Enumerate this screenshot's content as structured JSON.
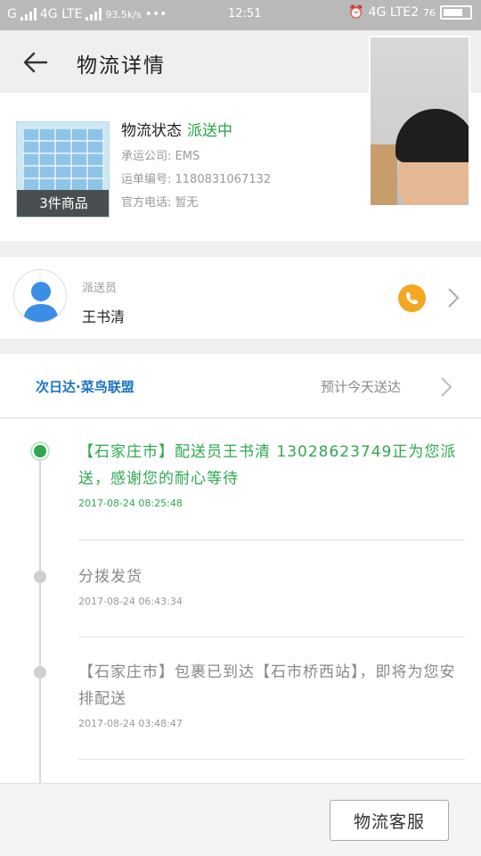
{
  "status_bar": {
    "carrier_left": "G",
    "network_left": "4G LTE",
    "speed": "93.5k/s",
    "dots": "•••",
    "time": "12:51",
    "network_right": "4G LTE2",
    "battery": "76"
  },
  "header": {
    "title": "物流详情"
  },
  "shipment": {
    "items_count": "3件商品",
    "status_label": "物流状态",
    "status_value": "派送中",
    "carrier": "承运公司: EMS",
    "tracking": "运单编号: 1180831067132",
    "phone": "官方电话: 暂无"
  },
  "courier": {
    "label": "派送员",
    "name": "王书清"
  },
  "partner": {
    "brand": "次日达·菜鸟联盟",
    "eta": "预计今天送达"
  },
  "timeline": [
    {
      "text": "【石家庄市】配送员王书清 13028623749正为您派送，感谢您的耐心等待",
      "time": "2017-08-24 08:25:48"
    },
    {
      "text": "分拨发货",
      "time": "2017-08-24 06:43:34"
    },
    {
      "text": "【石家庄市】包裹已到达【石市桥西站】，即将为您安排配送",
      "time": "2017-08-24 03:48:47"
    }
  ],
  "footer": {
    "service_button": "物流客服"
  },
  "colors": {
    "accent_green": "#2fa852",
    "phone_orange": "#f5a623",
    "brand_blue": "#1a73c4"
  }
}
